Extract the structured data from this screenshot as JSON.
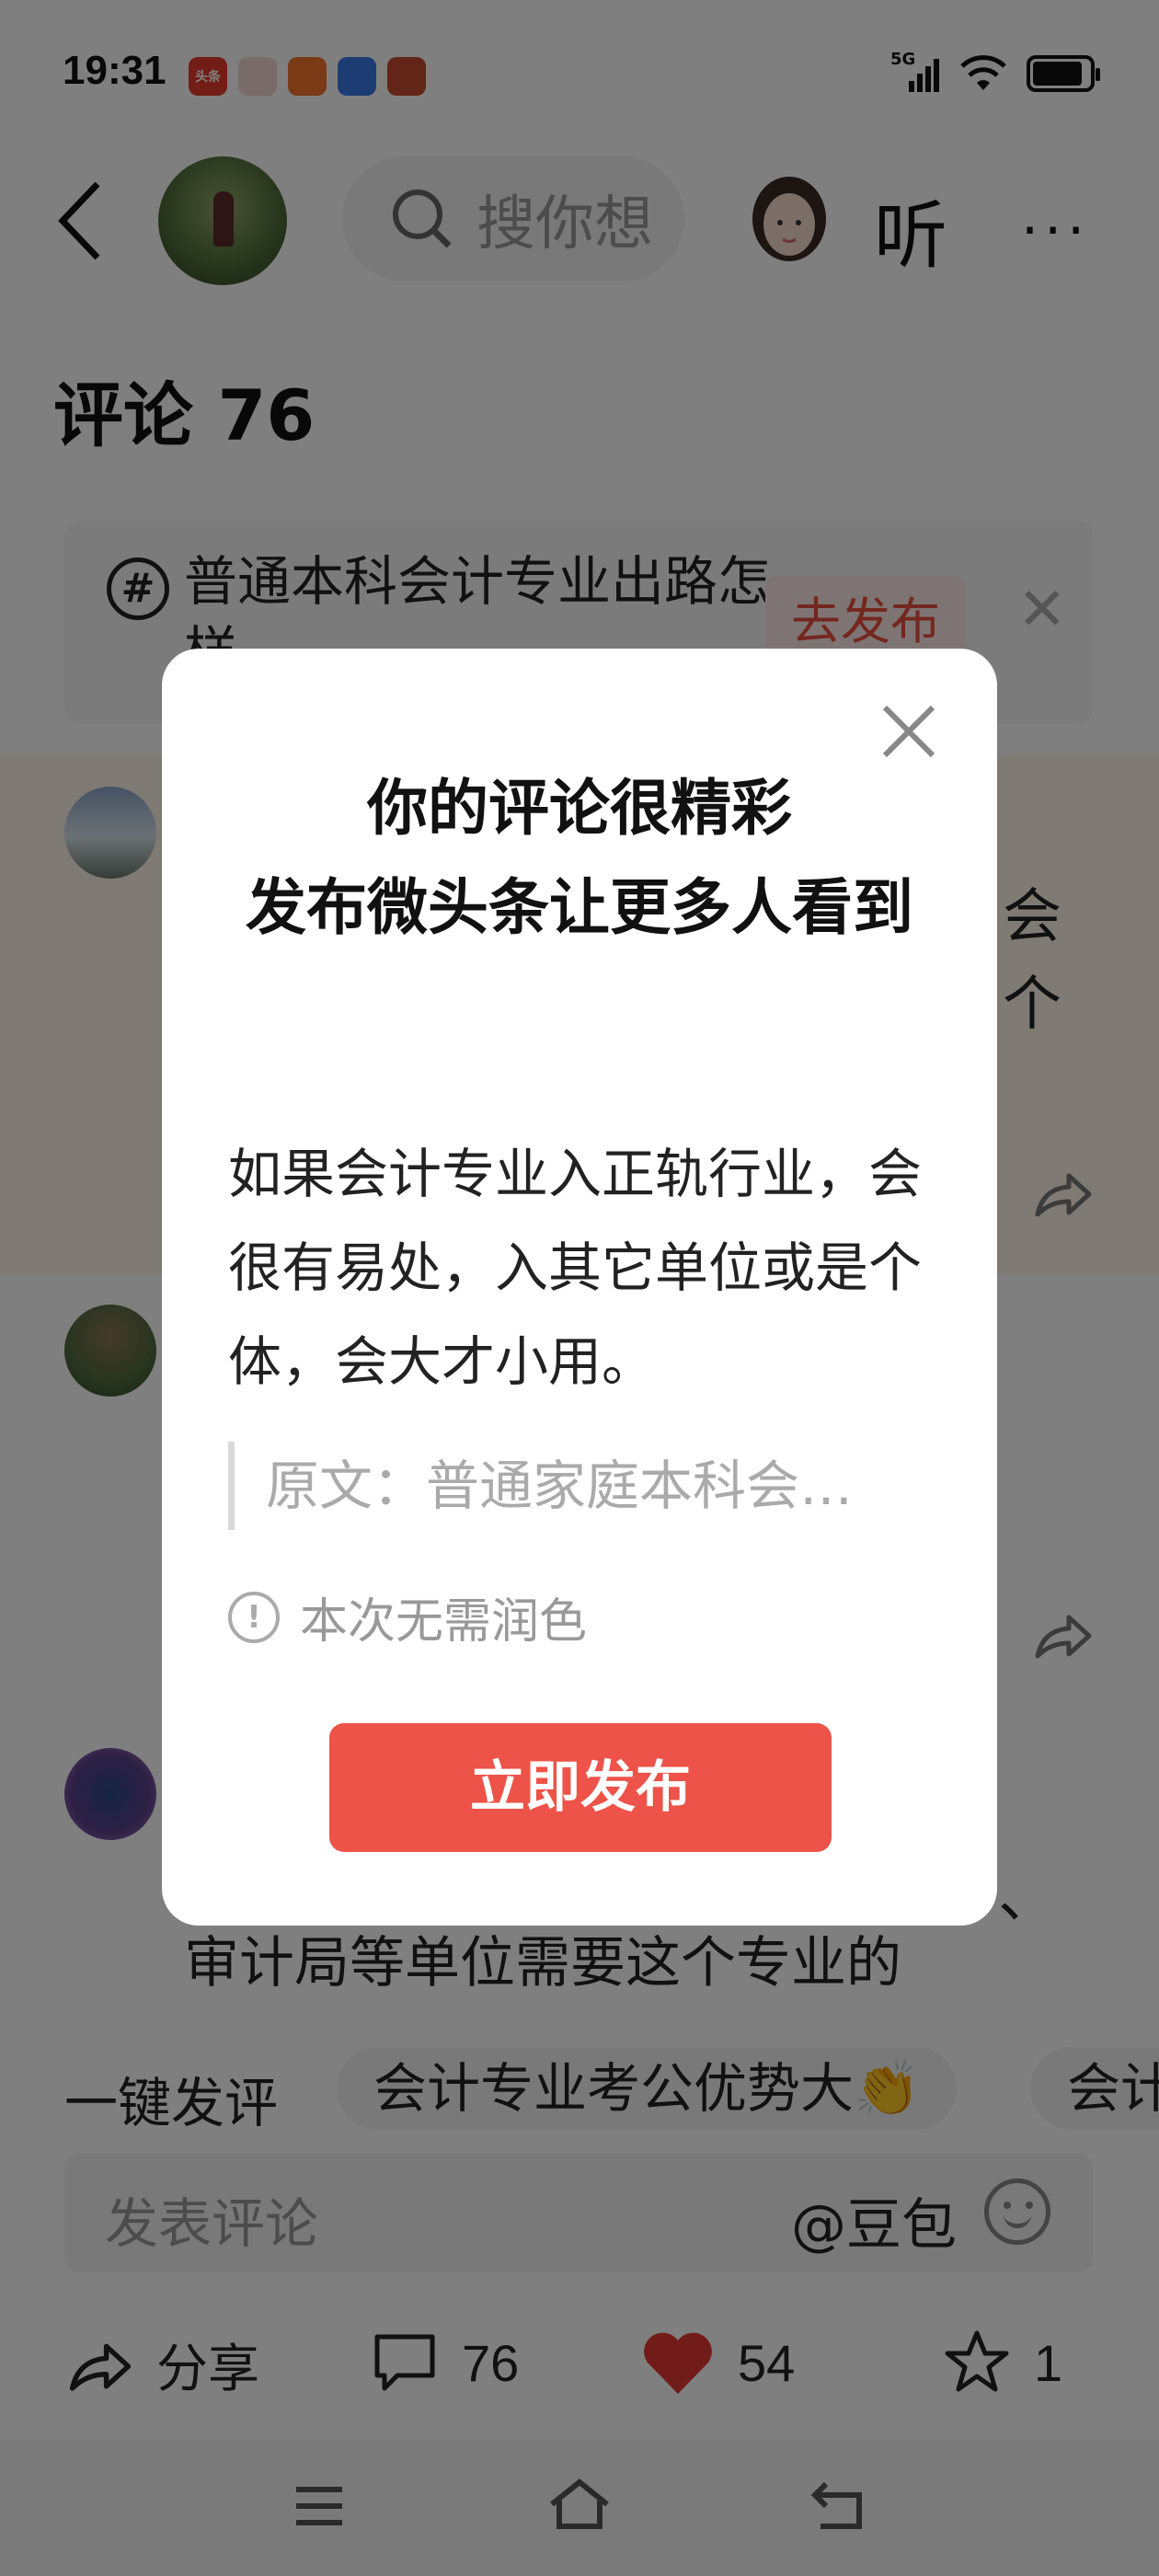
{
  "status_bar": {
    "time": "19:31",
    "network": "5G",
    "app_icons": [
      "toutiao-app-icon",
      "avatar-app-icon",
      "grid-app-icon",
      "baidu-app-icon",
      "game-app-icon"
    ],
    "toutiao_label": "头条"
  },
  "header": {
    "search_placeholder": "搜你想",
    "listen_label": "听",
    "more_label": "···"
  },
  "comments": {
    "title": "评论 76"
  },
  "topic": {
    "text": "普通本科会计专业出路怎样",
    "button": "去发布"
  },
  "background_comments": {
    "c1_right_line1": "会",
    "c1_right_line2": "个",
    "c3_line": "审计局等单位需要这个专业的",
    "c3_side": "、"
  },
  "quick_comments": {
    "label": "一键发评",
    "chips": [
      "会计专业考公优势大👏",
      "会计"
    ]
  },
  "comment_input": {
    "placeholder": "发表评论",
    "mention": "@豆包"
  },
  "actions": {
    "share": "分享",
    "comments": "76",
    "likes": "54",
    "favorites": "1"
  },
  "dialog": {
    "title_line1": "你的评论很精彩",
    "title_line2": "发布微头条让更多人看到",
    "body": "如果会计专业入正轨行业，会很有易处，入其它单位或是个体，会大才小用。",
    "quote": "原文：普通家庭本科会…",
    "note": "本次无需润色",
    "publish_button": "立即发布"
  },
  "colors": {
    "accent": "#ed5349",
    "like": "#e53935",
    "overlay": "rgba(0,0,0,0.5)"
  }
}
